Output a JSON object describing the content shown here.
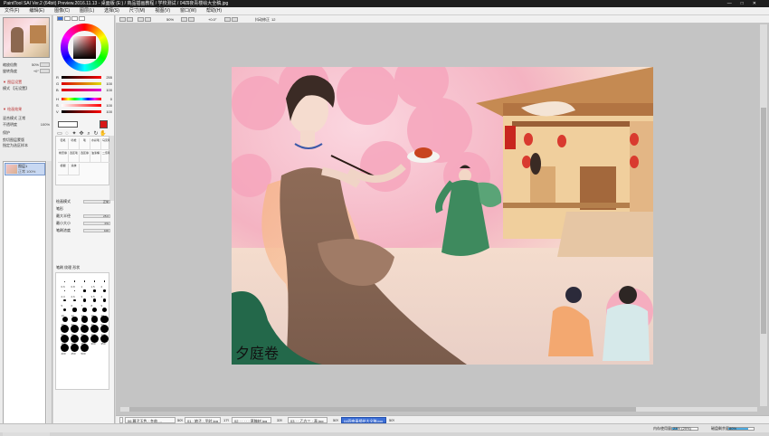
{
  "app": {
    "title": "PaintTool SAI Ver.2 (64bit) Preview.2016.11.13 - 桌面版 (E:) / 商品插画教程 / 学校测试 / 04四夜青楼绘大全稿.jpg",
    "window_buttons": [
      "—",
      "□",
      "✕"
    ]
  },
  "menu": {
    "items": [
      "文件(F)",
      "编辑(E)",
      "图像(C)",
      "图层(L)",
      "选择(S)",
      "尺寸(M)",
      "视图(V)",
      "窗口(W)",
      "帮助(H)"
    ]
  },
  "navigator": {
    "zoom_label": "缩放倍数",
    "zoom_value": "50%",
    "angle_label": "旋转角度",
    "angle_value": "+0°",
    "section_layer": "▼ 图层设置",
    "blend_label": "模式",
    "blend_value": "【无设置】",
    "section_paint": "▼ 绘画效果",
    "mode_label": "混合模式",
    "mode_value": "正常",
    "opacity_label": "不透明度",
    "opacity_value": "100%",
    "protect_label": "保护",
    "clip_label": "剪切图层蒙版",
    "ref_label": "指定为选区样本"
  },
  "layers": [
    {
      "name": "图层1",
      "info": "正常 100%"
    }
  ],
  "colors": {
    "primary": "#d81818",
    "secondary": "#ffffff",
    "accent": "#3b6fd6"
  },
  "sliders": [
    {
      "label": "R",
      "value": "255"
    },
    {
      "label": "G",
      "value": "100"
    },
    {
      "label": "B",
      "value": "100"
    },
    {
      "label": "H",
      "value": "0"
    },
    {
      "label": "S",
      "value": "100"
    },
    {
      "label": "V",
      "value": "100"
    }
  ],
  "tools": {
    "icons": [
      "select-icon",
      "lasso-icon",
      "magic-wand-icon",
      "move-icon",
      "zoom-icon",
      "rotate-icon",
      "hand-icon",
      "eyedropper-icon"
    ],
    "brushes": [
      "铅笔",
      "喷枪",
      "笔",
      "水彩笔",
      "马克笔",
      "橡皮擦",
      "选区笔",
      "选区擦",
      "油漆桶",
      "二值笔",
      "模糊",
      "涂抹"
    ]
  },
  "brush_props": {
    "blend_label": "绘画模式",
    "blend_value": "正常",
    "shape_label": "笔形",
    "size_label": "最大半径",
    "size_value": "25.0",
    "minsize_label": "最小大小",
    "minsize_value": "0%",
    "density_label": "笔刷浓度",
    "density_value": "100",
    "tabs": [
      "笔刷",
      "纹理",
      "形状"
    ]
  },
  "sizes": [
    "0.6",
    "0.8",
    "1",
    "1.5",
    "2",
    "2.3",
    "2.6",
    "3",
    "3.5",
    "4",
    "5",
    "6",
    "7",
    "8",
    "9",
    "10",
    "12",
    "14",
    "16",
    "20",
    "25",
    "30",
    "35",
    "40",
    "50",
    "60",
    "70",
    "80",
    "100",
    "120",
    "160",
    "200",
    "250",
    "300",
    "350",
    "400",
    "450",
    "500"
  ],
  "canvas_toolbar": {
    "zoom": "50%",
    "angle": "+0.0°",
    "stab_label": "抖动修正",
    "stab_value": "12"
  },
  "artwork": {
    "signature": "夕庭卷"
  },
  "taskbar": [
    {
      "name": "06 暮子玉色 · 冬韵 …",
      "pct": "50%"
    },
    {
      "name": "01 · 娘子 · 平时.jpg",
      "pct": "17%"
    },
    {
      "name": "02 · · · · · 草稿材.jpg",
      "pct": "33%"
    },
    {
      "name": "03 · · 乙方三 · 表.jpg",
      "pct": "50%"
    },
    {
      "name": "04四夜青楼绘大全稿.jpg",
      "pct": "50%"
    }
  ],
  "status": {
    "mem_label": "内存使用量",
    "mem_value": "23% (29%)",
    "disk_label": "磁盘剩余量",
    "disk_value": "80%"
  }
}
